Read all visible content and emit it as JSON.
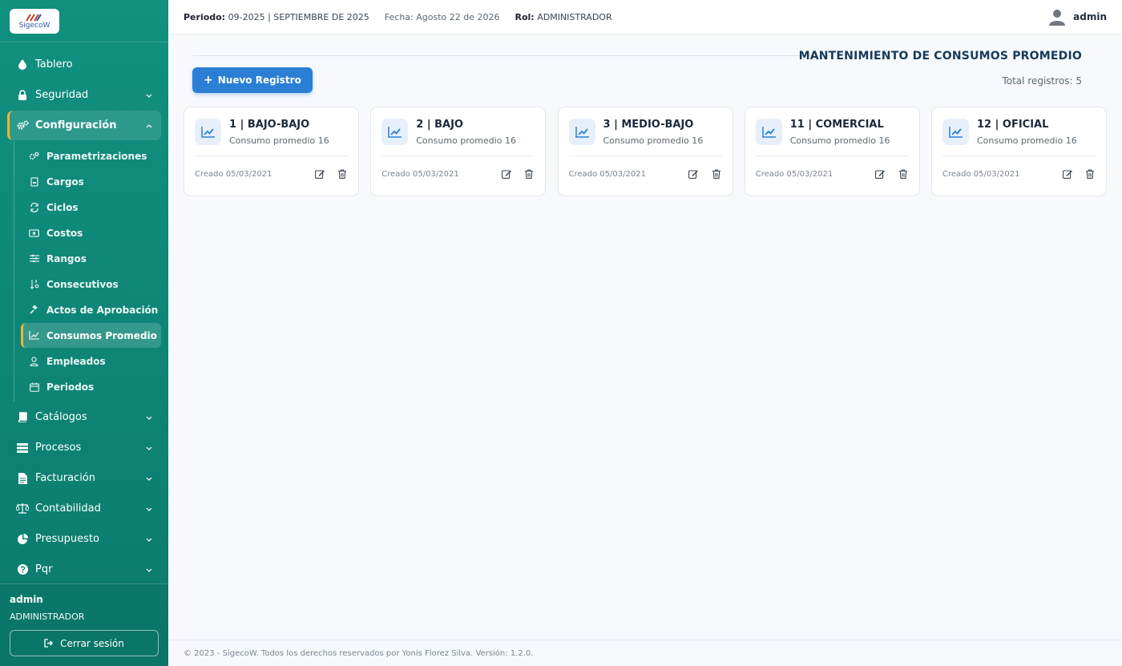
{
  "brand": {
    "logo_text": "SigecoW"
  },
  "sidebar": {
    "items": [
      {
        "label": "Tablero",
        "icon": "drop-icon"
      },
      {
        "label": "Seguridad",
        "icon": "lock-icon"
      },
      {
        "label": "Configuración",
        "icon": "gears-icon"
      }
    ],
    "config_sub": [
      {
        "label": "Parametrizaciones",
        "icon": "gears-icon"
      },
      {
        "label": "Cargos",
        "icon": "badge-icon"
      },
      {
        "label": "Ciclos",
        "icon": "sync-icon"
      },
      {
        "label": "Costos",
        "icon": "money-icon"
      },
      {
        "label": "Rangos",
        "icon": "sliders-icon"
      },
      {
        "label": "Consecutivos",
        "icon": "sort-numeric-icon"
      },
      {
        "label": "Actos de Aprobación",
        "icon": "gavel-icon"
      },
      {
        "label": "Consumos Promedio",
        "icon": "chart-line-icon"
      },
      {
        "label": "Empleados",
        "icon": "user-icon"
      },
      {
        "label": "Periodos",
        "icon": "calendar-icon"
      }
    ],
    "more_items": [
      {
        "label": "Catálogos",
        "icon": "book-icon"
      },
      {
        "label": "Procesos",
        "icon": "server-icon"
      },
      {
        "label": "Facturación",
        "icon": "invoice-icon"
      },
      {
        "label": "Contabilidad",
        "icon": "scale-icon"
      },
      {
        "label": "Presupuesto",
        "icon": "pie-icon"
      },
      {
        "label": "Pqr",
        "icon": "question-icon"
      }
    ],
    "user": {
      "name": "admin",
      "role": "ADMINISTRADOR",
      "logout": "Cerrar sesión"
    }
  },
  "topbar": {
    "periodo_label": "Periodo:",
    "periodo_value": "09-2025 | SEPTIEMBRE DE 2025",
    "fecha": "Fecha: Agosto 22 de 2026",
    "rol_label": "Rol:",
    "rol_value": "ADMINISTRADOR",
    "user": "admin"
  },
  "main": {
    "title": "MANTENIMIENTO DE CONSUMOS PROMEDIO",
    "new_button": "Nuevo Registro",
    "total": "Total registros: 5",
    "cards": [
      {
        "title": "1 | BAJO-BAJO",
        "subtitle": "Consumo promedio 16",
        "created": "Creado 05/03/2021"
      },
      {
        "title": "2 | BAJO",
        "subtitle": "Consumo promedio 16",
        "created": "Creado 05/03/2021"
      },
      {
        "title": "3 | MEDIO-BAJO",
        "subtitle": "Consumo promedio 16",
        "created": "Creado 05/03/2021"
      },
      {
        "title": "11 | COMERCIAL",
        "subtitle": "Consumo promedio 16",
        "created": "Creado 05/03/2021"
      },
      {
        "title": "12 | OFICIAL",
        "subtitle": "Consumo promedio 16",
        "created": "Creado 05/03/2021"
      }
    ]
  },
  "footer": {
    "text": "© 2023 - SigecoW. Todos los derechos reservados por Yonis Florez Silva. Versión: 1.2.0."
  },
  "colors": {
    "sidebar": "#11907f",
    "accent": "#2a7fd4",
    "active_marker": "#f2b52f",
    "title": "#153a5b"
  }
}
